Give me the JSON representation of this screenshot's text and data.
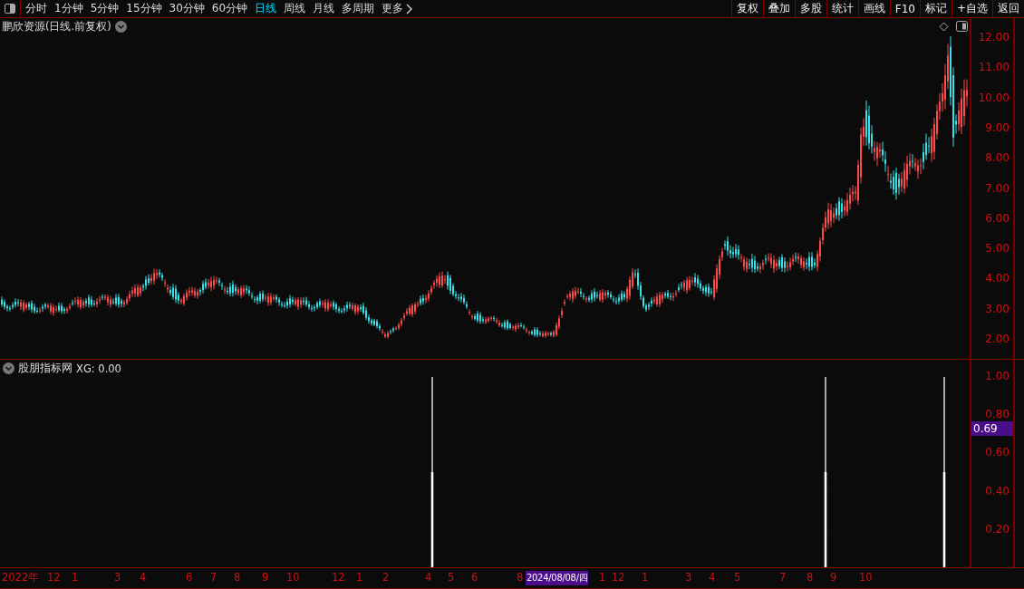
{
  "toolbar": {
    "periods": [
      {
        "label": "分时",
        "selected": false
      },
      {
        "label": "1分钟",
        "selected": false
      },
      {
        "label": "5分钟",
        "selected": false
      },
      {
        "label": "15分钟",
        "selected": false
      },
      {
        "label": "30分钟",
        "selected": false
      },
      {
        "label": "60分钟",
        "selected": false
      },
      {
        "label": "日线",
        "selected": true
      },
      {
        "label": "周线",
        "selected": false
      },
      {
        "label": "月线",
        "selected": false
      },
      {
        "label": "多周期",
        "selected": false
      },
      {
        "label": "更多",
        "selected": false
      }
    ],
    "actions": [
      "复权",
      "叠加",
      "多股",
      "统计",
      "画线",
      "F10",
      "标记",
      "+自选",
      "返回"
    ]
  },
  "main_chart": {
    "title": "鹏欣资源(日线.前复权)",
    "yticks": [
      "12.00",
      "11.00",
      "10.00",
      "9.00",
      "8.00",
      "7.00",
      "6.00",
      "5.00",
      "4.00",
      "3.00",
      "2.00"
    ]
  },
  "indicator": {
    "title": "股朋指标网",
    "reading": "XG: 0.00",
    "yticks": [
      "1.00",
      "0.80",
      "0.60",
      "0.40",
      "0.20"
    ],
    "crosshair_value": "0.69"
  },
  "date_axis": {
    "labels": [
      "2022年",
      "12",
      "1",
      "3",
      "4",
      "6",
      "7",
      "8",
      "9",
      "10",
      "12",
      "1",
      "2",
      "4",
      "5",
      "6",
      "8",
      "1",
      "12",
      "1",
      "3",
      "4",
      "5",
      "7",
      "8",
      "9",
      "10"
    ],
    "crosshair_date": "2024/08/08/四"
  }
}
